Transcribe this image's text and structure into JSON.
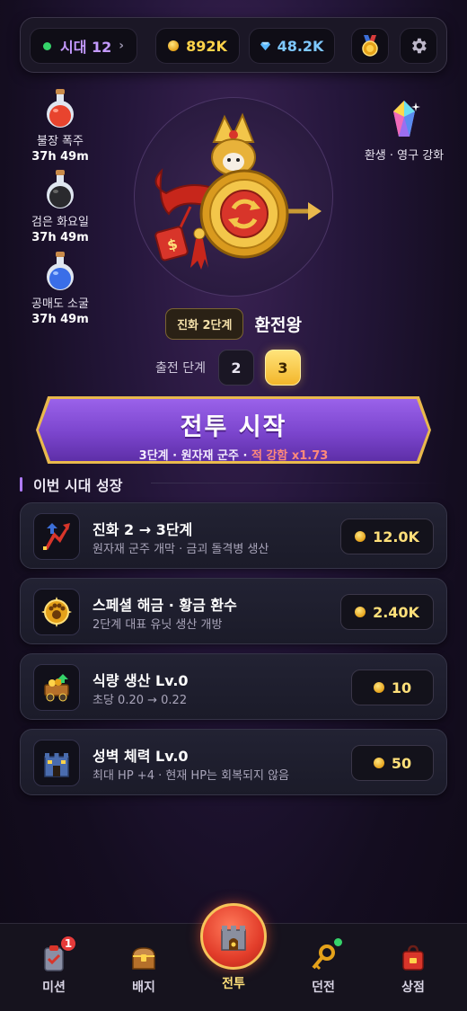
{
  "topbar": {
    "era": "시대 12",
    "era_chevron": "›",
    "gold": "892K",
    "gems": "48.2K",
    "icons": {
      "gold": "gold-coin-icon",
      "gem": "gem-icon",
      "medal": "medal-icon",
      "settings": "gear-icon"
    }
  },
  "buffs": [
    {
      "name": "불장 폭주",
      "time": "37h 49m",
      "color": "#e8442e"
    },
    {
      "name": "검은 화요일",
      "time": "37h 49m",
      "color": "#2a2a2e"
    },
    {
      "name": "공매도 소굴",
      "time": "37h 49m",
      "color": "#3a6ee8"
    }
  ],
  "rebirth": {
    "label": "환생 · 영구 강화"
  },
  "hero": {
    "evolution_badge": "진화 2단계",
    "name": "환전왕"
  },
  "stage": {
    "label": "출전 단계",
    "options": [
      "2",
      "3"
    ],
    "selected": "3"
  },
  "battle": {
    "title": "전투 시작",
    "sub_main": "3단계 · 원자재 군주 · ",
    "sub_warn": "적 강함 x1.73"
  },
  "section": {
    "title": "이번 시대 성장"
  },
  "upgrades": [
    {
      "title": "진화 2 → 3단계",
      "desc": "원자재 군주 개막 · 금괴 돌격병 생산",
      "price": "12.0K",
      "icon": "evolution-arrow-icon"
    },
    {
      "title": "스페셜 해금 · 황금 환수",
      "desc": "2단계 대표 유닛 생산 개방",
      "price": "2.40K",
      "icon": "golden-beast-icon"
    },
    {
      "title": "식량 생산 Lv.0",
      "desc": "초당 0.20 → 0.22",
      "price": "10",
      "icon": "food-cart-icon"
    },
    {
      "title": "성벽 체력 Lv.0",
      "desc": "최대 HP +4 · 현재 HP는 회복되지 않음",
      "price": "50",
      "icon": "castle-wall-icon"
    }
  ],
  "nav": {
    "mission": {
      "label": "미션",
      "badge": "1"
    },
    "badge": {
      "label": "배지"
    },
    "battle": {
      "label": "전투"
    },
    "dungeon": {
      "label": "던전"
    },
    "shop": {
      "label": "상점"
    }
  }
}
